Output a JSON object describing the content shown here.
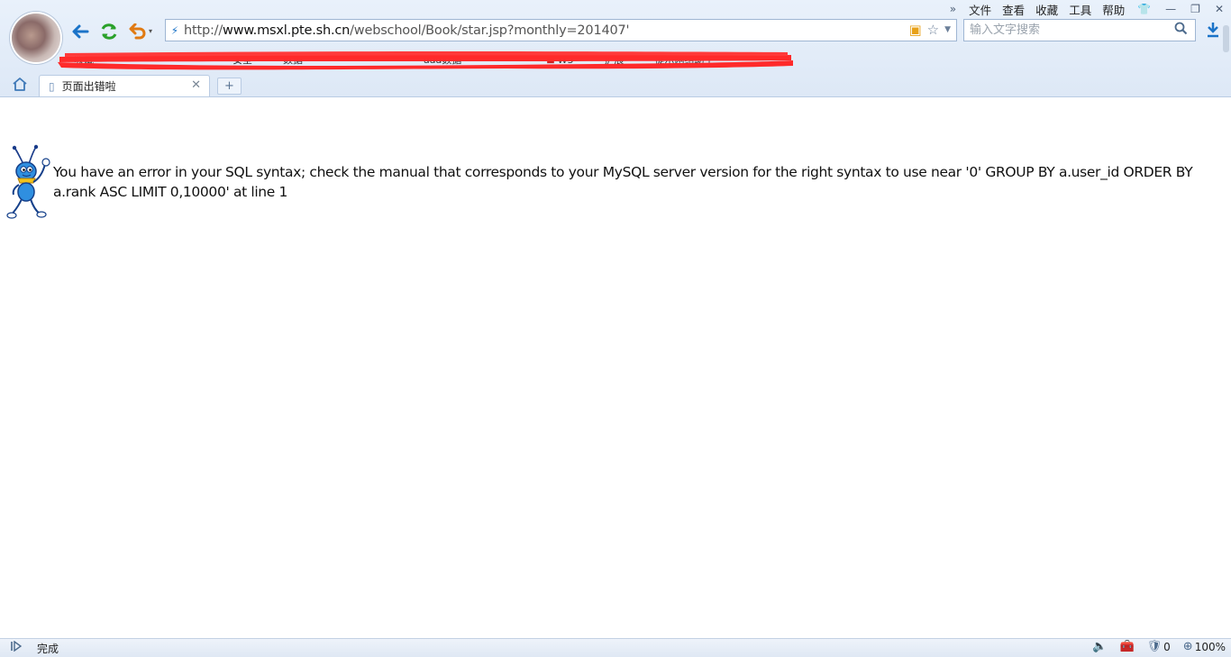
{
  "menu": {
    "items": [
      "文件",
      "查看",
      "收藏",
      "工具",
      "帮助"
    ],
    "more": "»"
  },
  "nav": {
    "back": "←",
    "refresh": "⟳",
    "undo": "↶",
    "undo_dropdown": "▾"
  },
  "address": {
    "scheme": "http://",
    "host": "www.msxl.pte.sh.cn",
    "path": "/webschool/Book/star.jsp?monthly=201407'"
  },
  "search": {
    "placeholder": "输入文字搜索",
    "value": ""
  },
  "bookmarks": [
    {
      "label": "收藏"
    },
    {
      "label": "安全"
    },
    {
      "label": "数据"
    },
    {
      "label": "aaa数据"
    },
    {
      "label": "W3"
    },
    {
      "label": "扩展"
    },
    {
      "label": "提示网络助手"
    }
  ],
  "tabs": [
    {
      "title": "页面出错啦",
      "active": true
    }
  ],
  "new_tab": "+",
  "page": {
    "error_message": "You have an error in your SQL syntax; check the manual that corresponds to your MySQL server version for the right syntax to use near '0' GROUP BY a.user_id ORDER BY a.rank ASC LIMIT 0,10000' at line 1"
  },
  "status": {
    "text": "完成",
    "count": "0",
    "zoom": "100%"
  },
  "colors": {
    "chrome_bg": "#e3ecf8",
    "accent": "#1a73c8",
    "refresh": "#2aa12a",
    "undo": "#e07a12",
    "redaction": "#ff2020"
  }
}
